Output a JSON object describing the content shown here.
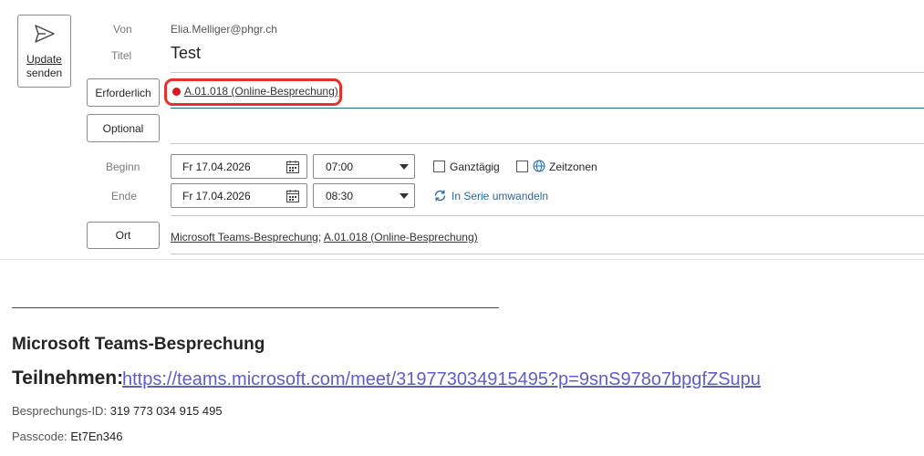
{
  "send_button": {
    "line1": "Update",
    "line2": "senden"
  },
  "from": {
    "label": "Von",
    "value": "Elia.Melliger@phgr.ch"
  },
  "title": {
    "label": "Titel",
    "value": "Test"
  },
  "required": {
    "label": "Erforderlich",
    "attendee": "A.01.018 (Online-Besprechung)"
  },
  "optional": {
    "label": "Optional"
  },
  "start": {
    "label": "Beginn",
    "date": "Fr 17.04.2026",
    "time": "07:00"
  },
  "end": {
    "label": "Ende",
    "date": "Fr 17.04.2026",
    "time": "08:30"
  },
  "options": {
    "all_day": "Ganztägig",
    "time_zones": "Zeitzonen",
    "recurrence": "In Serie umwandeln"
  },
  "location": {
    "button": "Ort",
    "item1": "Microsoft Teams-Besprechung",
    "separator": "; ",
    "item2": "A.01.018 (Online-Besprechung)"
  },
  "body": {
    "heading": "Microsoft Teams-Besprechung",
    "join_label": "Teilnehmen:",
    "join_url": "https://teams.microsoft.com/meet/319773034915495?p=9snS978o7bpgfZSupu",
    "meeting_id_label": "Besprechungs-ID:",
    "meeting_id": "319 773 034 915 495",
    "passcode_label": "Passcode:",
    "passcode": "Et7En346"
  },
  "colors": {
    "highlight": "#e8302a",
    "link": "#5b5fc7",
    "accent": "#1f6aa5"
  }
}
